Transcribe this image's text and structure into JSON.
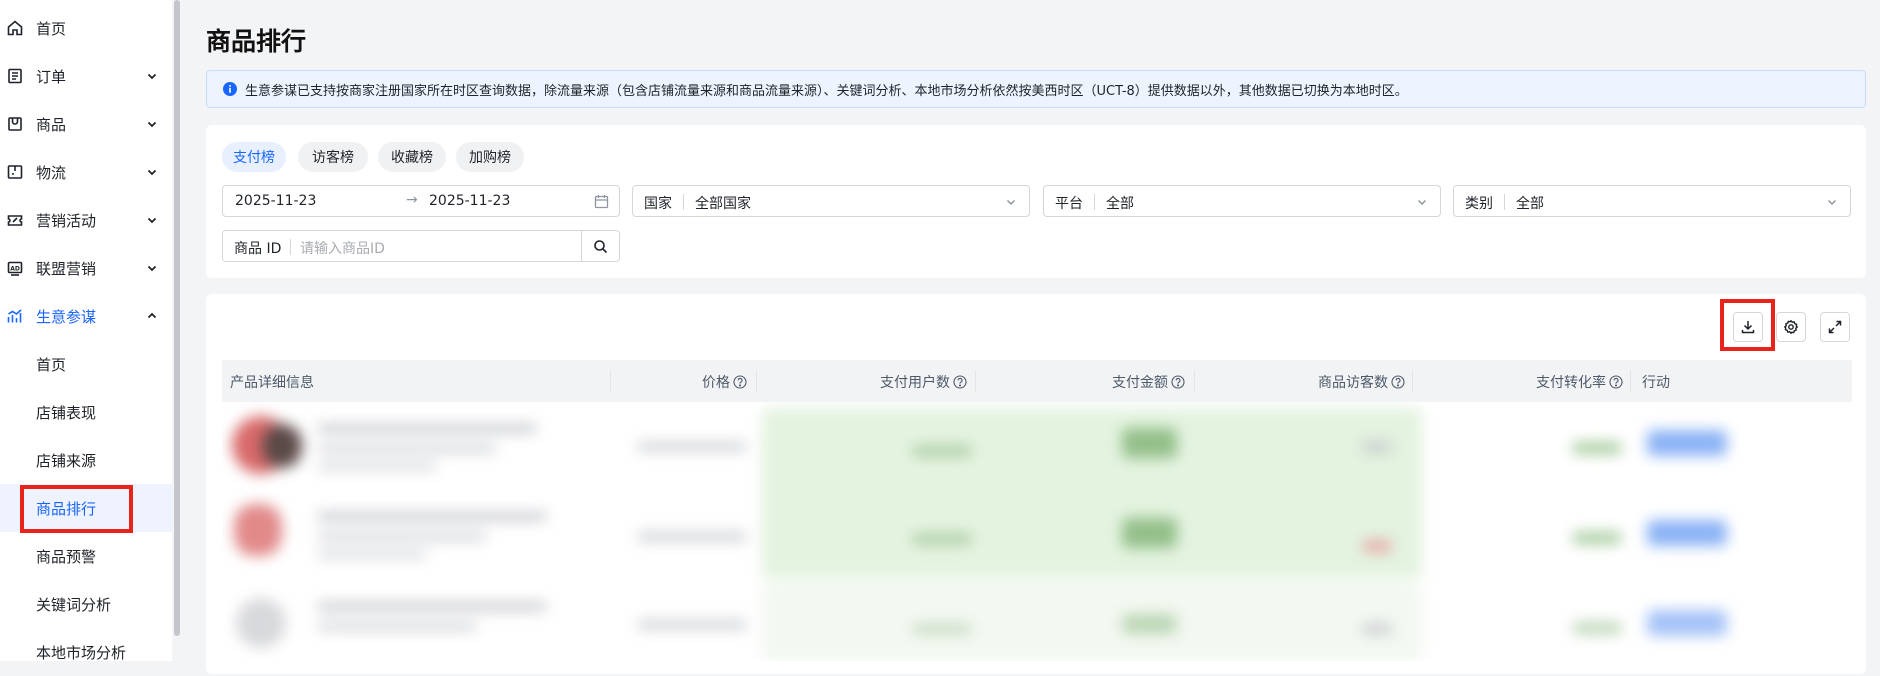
{
  "sidebar": {
    "items": [
      {
        "label": "首页",
        "icon": "home-icon",
        "expandable": false
      },
      {
        "label": "订单",
        "icon": "order-icon",
        "expandable": true
      },
      {
        "label": "商品",
        "icon": "product-icon",
        "expandable": true
      },
      {
        "label": "物流",
        "icon": "logistics-icon",
        "expandable": true
      },
      {
        "label": "营销活动",
        "icon": "marketing-icon",
        "expandable": true
      },
      {
        "label": "联盟营销",
        "icon": "affiliate-icon",
        "expandable": true
      },
      {
        "label": "生意参谋",
        "icon": "analytics-icon",
        "expandable": true,
        "expanded": true
      }
    ],
    "sub_items": [
      {
        "label": "首页"
      },
      {
        "label": "店铺表现"
      },
      {
        "label": "店铺来源"
      },
      {
        "label": "商品排行",
        "selected": true
      },
      {
        "label": "商品预警"
      },
      {
        "label": "关键词分析"
      },
      {
        "label": "本地市场分析"
      }
    ]
  },
  "page": {
    "title": "商品排行"
  },
  "notice": {
    "text": "生意参谋已支持按商家注册国家所在时区查询数据，除流量来源（包含店铺流量来源和商品流量来源）、关键词分析、本地市场分析依然按美西时区（UCT-8）提供数据以外，其他数据已切换为本地时区。",
    "icon": "info-icon"
  },
  "filters": {
    "tabs": [
      {
        "label": "支付榜",
        "active": true
      },
      {
        "label": "访客榜"
      },
      {
        "label": "收藏榜"
      },
      {
        "label": "加购榜"
      }
    ],
    "date_start": "2025-11-23",
    "date_end": "2025-11-23",
    "date_arrow": "→",
    "country": {
      "label": "国家",
      "value": "全部国家"
    },
    "platform": {
      "label": "平台",
      "value": "全部"
    },
    "category": {
      "label": "类别",
      "value": "全部"
    },
    "product_id": {
      "label": "商品 ID",
      "placeholder": "请输入商品ID"
    }
  },
  "table": {
    "columns": [
      "产品详细信息",
      "价格",
      "支付用户数",
      "支付金额",
      "商品访客数",
      "支付转化率",
      "行动"
    ]
  },
  "colors": {
    "accent": "#1966ff",
    "highlight": "#e8231b",
    "notice_bg": "#eef4ff"
  }
}
